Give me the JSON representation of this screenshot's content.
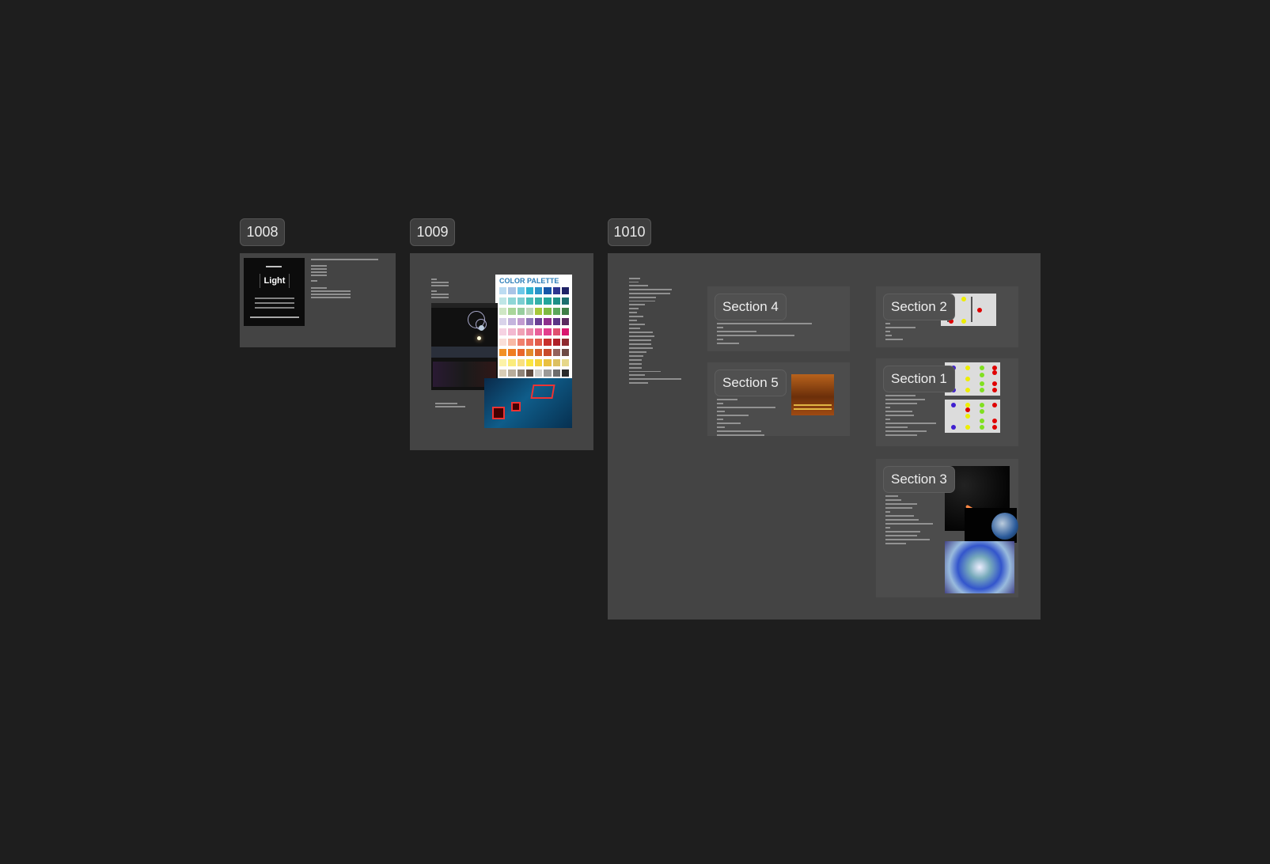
{
  "frames": [
    {
      "label": "1008"
    },
    {
      "label": "1009"
    },
    {
      "label": "1010"
    }
  ],
  "frame1008": {
    "poster_word": "Light"
  },
  "frame1009": {
    "palette_title": "COLOR PALETTE",
    "palette_colors": [
      [
        "#bcdcf2",
        "#a9c4e6",
        "#6cc7e8",
        "#2fb3cf",
        "#2a93c9",
        "#1757a8",
        "#2e3590",
        "#1f2266"
      ],
      [
        "#bfe6e6",
        "#8fd6d6",
        "#7ccdd1",
        "#48bdb9",
        "#35b0a8",
        "#23a59a",
        "#1d8f86",
        "#1c6e6e"
      ],
      [
        "#cfe7c5",
        "#a9d69a",
        "#98ce9f",
        "#bfd6b9",
        "#a6c83a",
        "#7dbb43",
        "#5aa85c",
        "#3f7f47"
      ],
      [
        "#d9d3ea",
        "#c4b4dd",
        "#c29bd0",
        "#8f76b8",
        "#6a3f94",
        "#8e2f8c",
        "#5a3485",
        "#5b2a5f"
      ],
      [
        "#f6d3e2",
        "#f3b9d0",
        "#f0a2b5",
        "#ec88a9",
        "#e9609a",
        "#e33e8d",
        "#e0506f",
        "#d9176f"
      ],
      [
        "#fadfd8",
        "#f8b9a5",
        "#f0806d",
        "#ec6f5e",
        "#e25c4a",
        "#c9302c",
        "#b01f27",
        "#8f2a2f"
      ],
      [
        "#f29125",
        "#ef7d22",
        "#e9662b",
        "#e38b2a",
        "#d8612c",
        "#c84a2a",
        "#94625b",
        "#6e4a45"
      ],
      [
        "#fdf3a8",
        "#fbec7c",
        "#f9e07e",
        "#fbe542",
        "#f5d23b",
        "#e9c040",
        "#dcc060",
        "#e6d78a"
      ],
      [
        "#d9cdb6",
        "#b8ad9c",
        "#8e8378",
        "#5d4a3f",
        "#d0cfcb",
        "#9b9a98",
        "#6d6d6d",
        "#2b2b2b"
      ]
    ]
  },
  "frame1010": {
    "sections": [
      {
        "title": "Section 4"
      },
      {
        "title": "Section 5"
      },
      {
        "title": "Section 2"
      },
      {
        "title": "Section 1"
      },
      {
        "title": "Section 3"
      }
    ]
  },
  "colors": {
    "canvas": "#1e1e1e",
    "frame": "#444444",
    "section": "#4c4c4c"
  }
}
